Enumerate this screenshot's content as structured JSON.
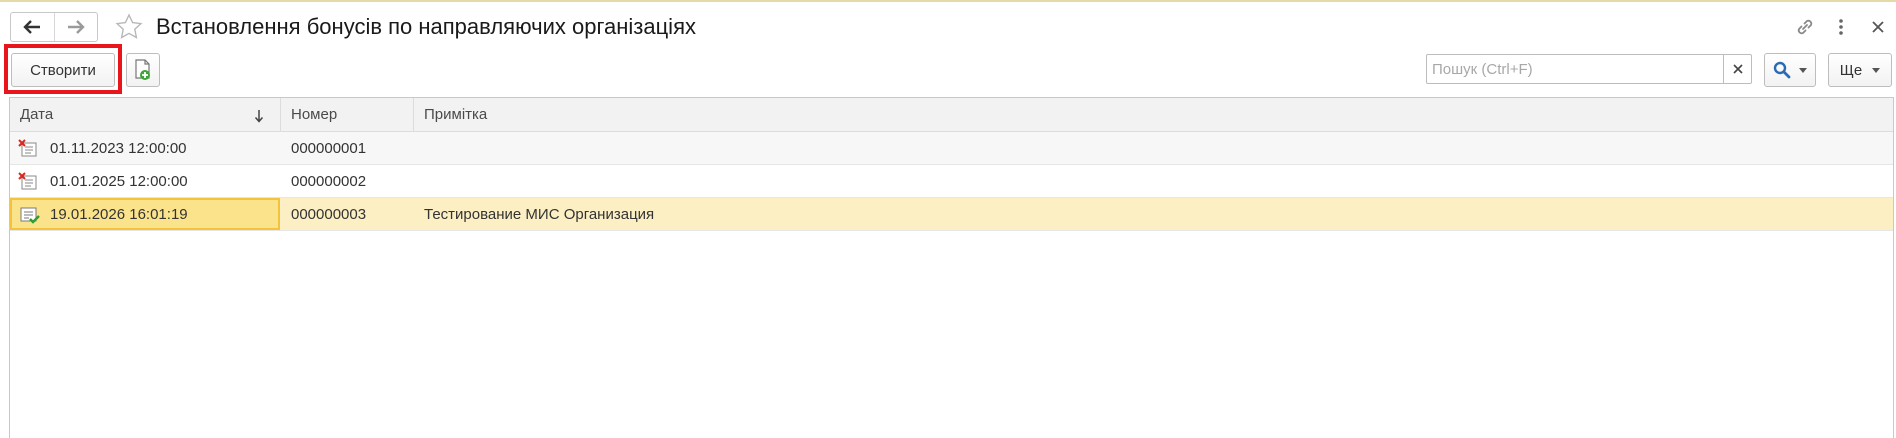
{
  "window": {
    "title": "Встановлення бонусів по направляючих організаціях",
    "back_icon": "arrow-left-icon",
    "forward_icon": "arrow-right-icon",
    "favorite_icon": "star-icon",
    "link_icon": "link-icon",
    "more_icon": "vertical-dots-icon",
    "close_icon": "close-icon"
  },
  "toolbar": {
    "create_label": "Створити",
    "create_new_icon": "document-add-icon",
    "search_placeholder": "Пошук (Ctrl+F)",
    "search_value": "",
    "clear_label": "×",
    "search_icon": "magnifier-icon",
    "more_label": "Ще"
  },
  "table": {
    "columns": [
      {
        "label": "Дата",
        "sort": "descending"
      },
      {
        "label": "Номер"
      },
      {
        "label": "Примітка"
      }
    ],
    "rows": [
      {
        "date": "01.11.2023 12:00:00",
        "number": "000000001",
        "note": "",
        "status": "deleted"
      },
      {
        "date": "01.01.2025 12:00:00",
        "number": "000000002",
        "note": "",
        "status": "deleted"
      },
      {
        "date": "19.01.2026 16:01:19",
        "number": "000000003",
        "note": "Тестирование МИС  Организация",
        "status": "posted",
        "selected": true
      }
    ]
  },
  "colors": {
    "highlight_box": "#e8161c",
    "selected_row": "#fbefc3",
    "selected_cell": "#fbe38c",
    "selected_border": "#f3c43b",
    "search_icon": "#2b6bb3"
  }
}
